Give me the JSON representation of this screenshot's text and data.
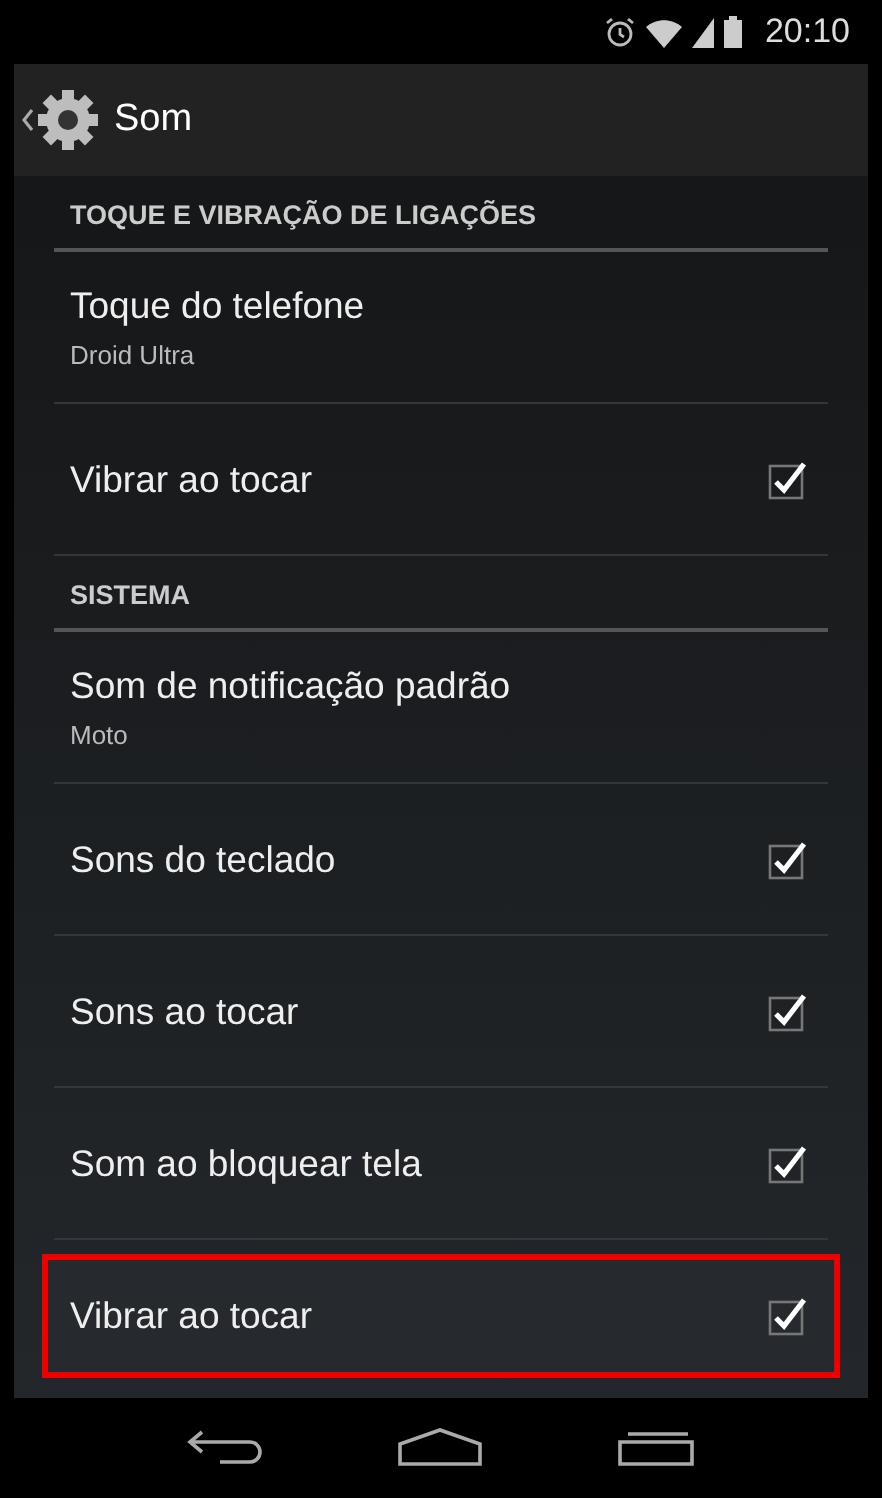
{
  "status_bar": {
    "time": "20:10"
  },
  "action_bar": {
    "title": "Som"
  },
  "items": [
    {
      "kind": "header",
      "title": "TOQUE E VIBRAÇÃO DE LIGAÇÕES"
    },
    {
      "kind": "detail",
      "title": "Toque do telefone",
      "summary": "Droid Ultra"
    },
    {
      "kind": "check",
      "title": "Vibrar ao tocar",
      "checked": true,
      "highlighted": false
    },
    {
      "kind": "header",
      "title": "SISTEMA"
    },
    {
      "kind": "detail",
      "title": "Som de notificação padrão",
      "summary": "Moto"
    },
    {
      "kind": "check",
      "title": "Sons do teclado",
      "checked": true,
      "highlighted": false
    },
    {
      "kind": "check",
      "title": "Sons ao tocar",
      "checked": true,
      "highlighted": false
    },
    {
      "kind": "check",
      "title": "Som ao bloquear tela",
      "checked": true,
      "highlighted": false
    },
    {
      "kind": "check",
      "title": "Vibrar ao tocar",
      "checked": true,
      "highlighted": true
    }
  ]
}
